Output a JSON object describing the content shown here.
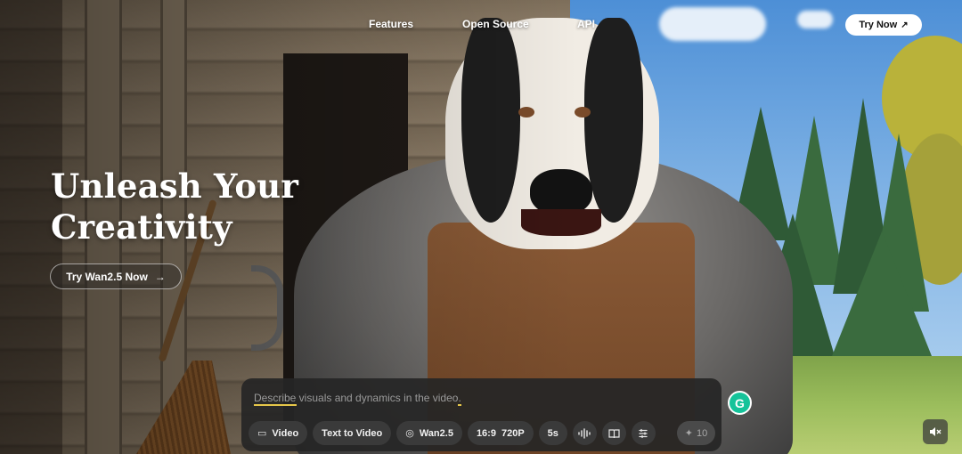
{
  "nav": {
    "features": "Features",
    "open_source": "Open Source",
    "api": "API",
    "try_now": "Try Now",
    "try_now_icon": "arrow-up-right-icon"
  },
  "hero": {
    "title_line1": "Unleash Your",
    "title_line2": "Creativity",
    "cta_label": "Try Wan2.5 Now",
    "cta_icon": "arrow-right-icon"
  },
  "prompt": {
    "placeholder": "Describe visuals and dynamics in the video.",
    "chips": {
      "mode": "Video",
      "type": "Text to Video",
      "model": "Wan2.5",
      "ratio": "16:9",
      "resolution": "720P",
      "duration": "5s"
    },
    "credits": "10"
  },
  "colors": {
    "accent_underline": "#e6c74a",
    "panel_bg": "#262626",
    "grammarly": "#15c39a"
  }
}
